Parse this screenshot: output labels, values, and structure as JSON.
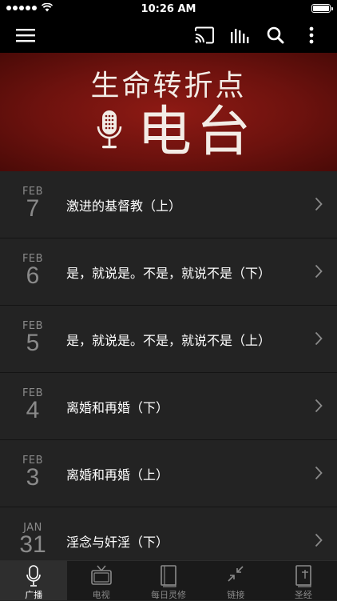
{
  "status_bar": {
    "time": "10:26 AM",
    "battery_level": 1.0
  },
  "nav": {
    "icons": [
      "menu-icon",
      "cast-icon",
      "equalizer-icon",
      "search-icon",
      "more-vertical-icon"
    ]
  },
  "banner": {
    "title": "生命转折点",
    "subtitle": "电台",
    "icon": "microphone-icon"
  },
  "episodes": [
    {
      "month": "FEB",
      "day": "7",
      "title": "激进的基督教（上）"
    },
    {
      "month": "FEB",
      "day": "6",
      "title": "是，就说是。不是，就说不是（下）"
    },
    {
      "month": "FEB",
      "day": "5",
      "title": "是，就说是。不是，就说不是（上）"
    },
    {
      "month": "FEB",
      "day": "4",
      "title": "离婚和再婚（下）"
    },
    {
      "month": "FEB",
      "day": "3",
      "title": "离婚和再婚（上）"
    },
    {
      "month": "JAN",
      "day": "31",
      "title": "淫念与奸淫（下）"
    }
  ],
  "tabs": [
    {
      "label": "广播",
      "icon": "microphone-icon",
      "active": true
    },
    {
      "label": "电视",
      "icon": "tv-icon",
      "active": false
    },
    {
      "label": "每日灵修",
      "icon": "book-icon",
      "active": false
    },
    {
      "label": "链接",
      "icon": "collapse-arrows-icon",
      "active": false
    },
    {
      "label": "圣经",
      "icon": "bible-icon",
      "active": false
    }
  ],
  "colors": {
    "banner": "#7a1510",
    "list_bg": "#232323",
    "bar_bg": "#000000"
  }
}
